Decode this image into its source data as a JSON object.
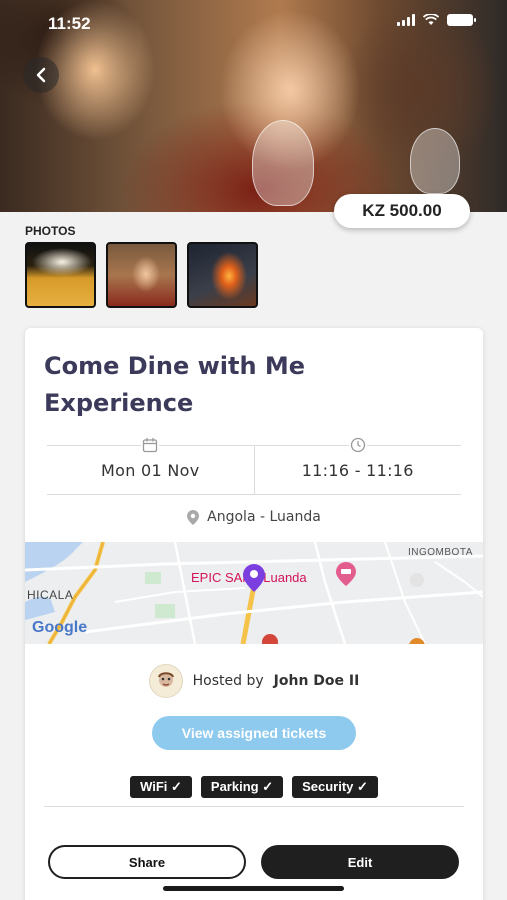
{
  "status_bar": {
    "time": "11:52"
  },
  "hero": {
    "back_icon": "chevron-left-icon"
  },
  "price": "KZ 500.00",
  "photos": {
    "label": "PHOTOS",
    "items": [
      "beer",
      "woman-eating",
      "grill-fire"
    ]
  },
  "event": {
    "title": "Come Dine with Me Experience",
    "date": "Mon 01 Nov",
    "time": "11:16 - 11:16",
    "location": "Angola - Luanda"
  },
  "map": {
    "labels": [
      "INGOMBOTA",
      "EPIC SANA Luanda",
      "HICALA",
      "Google"
    ]
  },
  "host": {
    "prefix": "Hosted by",
    "name": "John Doe II"
  },
  "tickets_button": "View assigned tickets",
  "amenities": [
    "WiFi ✓",
    "Parking ✓",
    "Security ✓"
  ],
  "actions": {
    "share": "Share",
    "edit": "Edit"
  },
  "colors": {
    "title": "#3b3a5a",
    "tickets": "#8ec9ee",
    "dark": "#1f1f1f",
    "map_pin": "#7b3fe0",
    "map_label": "#d4145a"
  }
}
